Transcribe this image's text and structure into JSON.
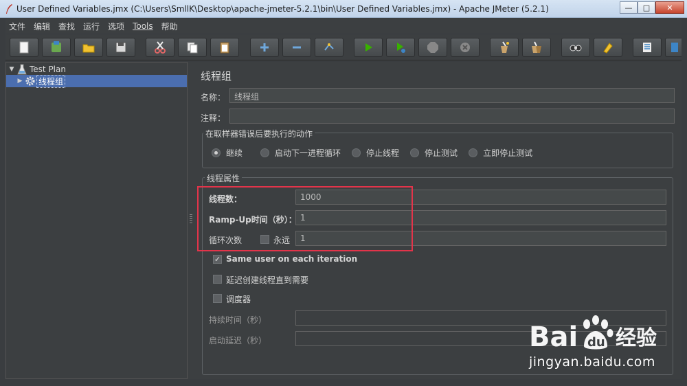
{
  "window": {
    "title": "User Defined Variables.jmx (C:\\Users\\SmllK\\Desktop\\apache-jmeter-5.2.1\\bin\\User Defined Variables.jmx) - Apache JMeter (5.2.1)",
    "minimize": "—",
    "maximize": "□",
    "close": "✕"
  },
  "menu": [
    {
      "label": "文件"
    },
    {
      "label": "编辑"
    },
    {
      "label": "查找"
    },
    {
      "label": "运行"
    },
    {
      "label": "选项"
    },
    {
      "label": "Tools"
    },
    {
      "label": "帮助"
    }
  ],
  "toolbar": {
    "buttons": [
      "new-icon",
      "templates-icon",
      "open-icon",
      "save-icon",
      "cut-icon",
      "copy-icon",
      "paste-icon",
      "expand-icon",
      "collapse-icon",
      "toggle-icon",
      "start-icon",
      "start-no-pause-icon",
      "stop-icon",
      "shutdown-icon",
      "clear-icon",
      "clear-all-icon",
      "search-icon",
      "reset-search-icon",
      "function-helper-icon",
      "help-icon"
    ]
  },
  "tree": {
    "root_label": "Test Plan",
    "child_label": "线程组"
  },
  "panel": {
    "heading": "线程组",
    "name_label": "名称：",
    "name_value": "线程组",
    "comment_label": "注释：",
    "comment_value": "",
    "error_group_title": "在取样器错误后要执行的动作",
    "error_options": [
      {
        "label": "继续",
        "selected": true
      },
      {
        "label": "启动下一进程循环",
        "selected": false
      },
      {
        "label": "停止线程",
        "selected": false
      },
      {
        "label": "停止测试",
        "selected": false
      },
      {
        "label": "立即停止测试",
        "selected": false
      }
    ],
    "props_group_title": "线程属性",
    "threads_label": "线程数：",
    "threads_value": "1000",
    "rampup_label": "Ramp-Up时间（秒）：",
    "rampup_value": "1",
    "loop_label": "循环次数",
    "forever_label": "永远",
    "forever_checked": false,
    "loop_value": "1",
    "same_user_label": "Same user on each iteration",
    "same_user_checked": true,
    "delay_label": "延迟创建线程直到需要",
    "delay_checked": false,
    "scheduler_label": "调度器",
    "scheduler_checked": false,
    "duration_label": "持续时间（秒）",
    "duration_value": "",
    "startup_delay_label": "启动延迟（秒）",
    "startup_delay_value": ""
  },
  "watermark": {
    "logo_text": "Bai",
    "logo_text2": "du",
    "logo_cn": "经验",
    "url": "jingyan.baidu.com"
  },
  "colors": {
    "background": "#3c3f41",
    "selection": "#4b6eaf",
    "highlight_box": "#e3344a",
    "titlebar": "#c8d8ec"
  }
}
